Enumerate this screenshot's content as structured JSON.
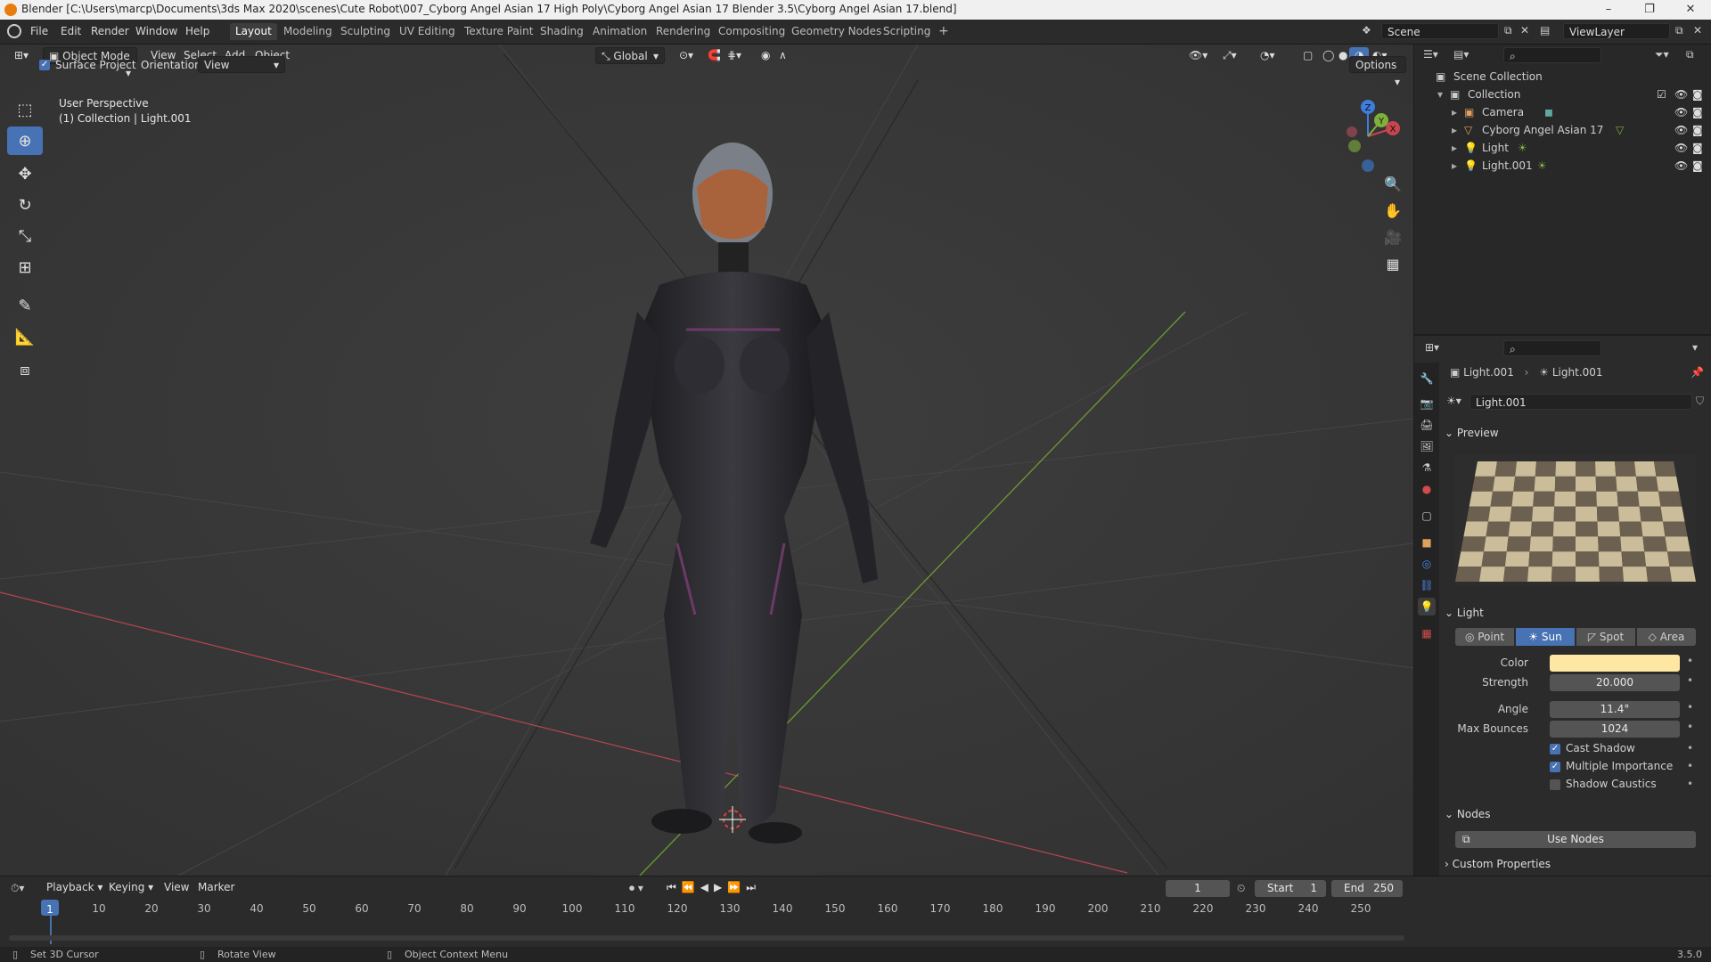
{
  "window": {
    "title": "Blender [C:\\Users\\marcp\\Documents\\3ds Max 2020\\scenes\\Cute Robot\\007_Cyborg Angel Asian 17 High Poly\\Cyborg Angel Asian 17 Blender 3.5\\Cyborg Angel Asian 17.blend]",
    "minimize": "–",
    "restore": "❐",
    "close": "✕"
  },
  "menu": [
    "File",
    "Edit",
    "Render",
    "Window",
    "Help"
  ],
  "workspaces": [
    {
      "label": "Layout",
      "active": true
    },
    {
      "label": "Modeling"
    },
    {
      "label": "Sculpting"
    },
    {
      "label": "UV Editing"
    },
    {
      "label": "Texture Paint"
    },
    {
      "label": "Shading"
    },
    {
      "label": "Animation"
    },
    {
      "label": "Rendering"
    },
    {
      "label": "Compositing"
    },
    {
      "label": "Geometry Nodes"
    },
    {
      "label": "Scripting"
    }
  ],
  "add_workspace": "+",
  "scene": {
    "name": "Scene",
    "view_layer": "ViewLayer"
  },
  "viewport": {
    "mode": "Object Mode",
    "menus": [
      "View",
      "Select",
      "Add",
      "Object"
    ],
    "transform_orientation": "Global",
    "options_label": "Options",
    "surface_project_label": "Surface Project",
    "orientation_label": "Orientation:",
    "orientation_value": "View",
    "overlay_line1": "User Perspective",
    "overlay_line2": "(1) Collection | Light.001",
    "gizmo": {
      "x": "X",
      "y": "Y",
      "z": "Z"
    }
  },
  "outliner": {
    "root": "Scene Collection",
    "collection": "Collection",
    "items": [
      "Camera",
      "Cyborg Angel Asian 17",
      "Light",
      "Light.001"
    ]
  },
  "properties": {
    "breadcrumb_object": "Light.001",
    "breadcrumb_data": "Light.001",
    "datablock": "Light.001",
    "preview_label": "Preview",
    "light_label": "Light",
    "light_types": [
      {
        "label": "Point"
      },
      {
        "label": "Sun",
        "active": true
      },
      {
        "label": "Spot"
      },
      {
        "label": "Area"
      }
    ],
    "color_label": "Color",
    "color_value": "#fde7a3",
    "strength_label": "Strength",
    "strength_value": "20.000",
    "angle_label": "Angle",
    "angle_value": "11.4°",
    "max_bounces_label": "Max Bounces",
    "max_bounces_value": "1024",
    "cast_shadow_label": "Cast Shadow",
    "cast_shadow": true,
    "multiple_importance_label": "Multiple Importance",
    "multiple_importance": true,
    "shadow_caustics_label": "Shadow Caustics",
    "shadow_caustics": false,
    "nodes_label": "Nodes",
    "use_nodes_label": "Use Nodes",
    "custom_properties_label": "Custom Properties"
  },
  "timeline": {
    "menus": [
      "Playback",
      "Keying",
      "View",
      "Marker"
    ],
    "current_frame": "1",
    "start_label": "Start",
    "start_value": "1",
    "end_label": "End",
    "end_value": "250",
    "ticks": [
      "1",
      "10",
      "20",
      "30",
      "40",
      "50",
      "60",
      "70",
      "80",
      "90",
      "100",
      "110",
      "120",
      "130",
      "140",
      "150",
      "160",
      "170",
      "180",
      "190",
      "200",
      "210",
      "220",
      "230",
      "240",
      "250"
    ]
  },
  "statusbar": {
    "left": "Set 3D Cursor",
    "middle": "Rotate View",
    "right": "Object Context Menu",
    "version": "3.5.0"
  },
  "colors": {
    "accent": "#4772b3",
    "x_axis": "#c8454f",
    "y_axis": "#7fb13a",
    "z_axis": "#3d7ddb"
  }
}
